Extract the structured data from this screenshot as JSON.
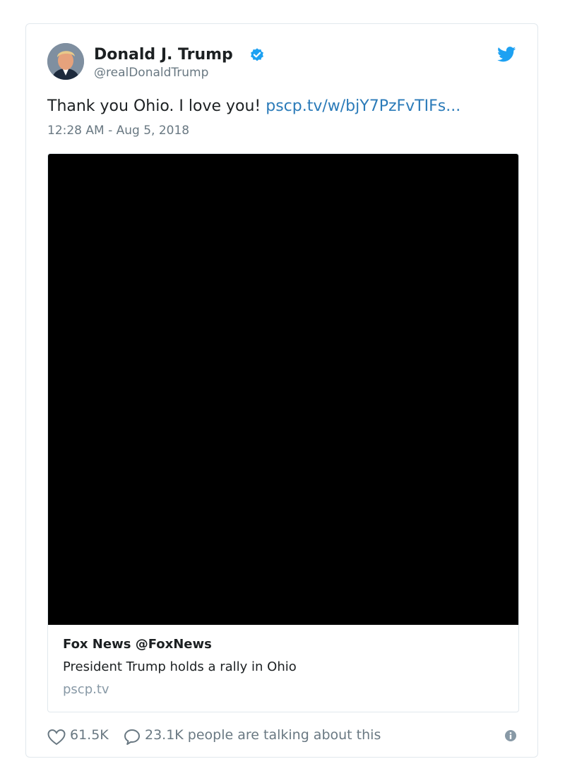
{
  "author": {
    "name": "Donald J. Trump",
    "handle": "@realDonaldTrump",
    "avatar_icon": "profile-photo",
    "verified": true
  },
  "tweet": {
    "text": "Thank you Ohio. I love you! ",
    "link": "pscp.tv/w/bjY7PzFvTIFs...",
    "timestamp": "12:28 AM - Aug 5, 2018"
  },
  "media_card": {
    "source": "Fox News @FoxNews",
    "title": "President Trump holds a rally in Ohio",
    "domain": "pscp.tv"
  },
  "footer": {
    "likes": "61.5K",
    "talking": "23.1K people are talking about this"
  },
  "colors": {
    "link": "#2b7bb9",
    "verified": "#1da1f2",
    "twitter_brand": "#1da1f2",
    "muted": "#697882"
  }
}
